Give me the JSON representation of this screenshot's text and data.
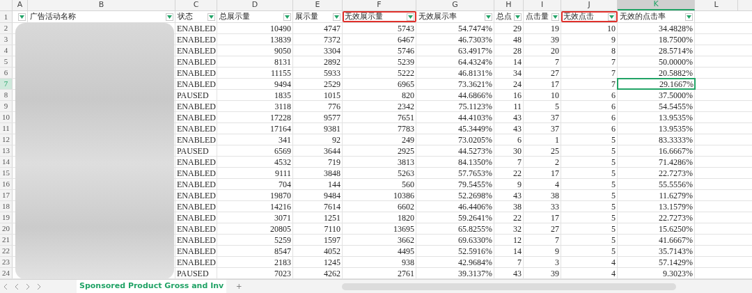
{
  "column_letters": [
    {
      "label": "A",
      "selected": false
    },
    {
      "label": "B",
      "selected": false
    },
    {
      "label": "C",
      "selected": false
    },
    {
      "label": "D",
      "selected": false
    },
    {
      "label": "E",
      "selected": false
    },
    {
      "label": "F",
      "selected": false
    },
    {
      "label": "G",
      "selected": false
    },
    {
      "label": "H",
      "selected": false
    },
    {
      "label": "I",
      "selected": false
    },
    {
      "label": "J",
      "selected": false
    },
    {
      "label": "K",
      "selected": true
    },
    {
      "label": "L",
      "selected": false
    }
  ],
  "header_row": {
    "number": "1",
    "cells": [
      {
        "highlighted": false
      },
      {
        "label": "广告活动名称",
        "highlighted": false
      },
      {
        "label": "状态",
        "highlighted": false
      },
      {
        "label": "总展示量",
        "highlighted": false
      },
      {
        "label": "展示量",
        "highlighted": false
      },
      {
        "label": "无效展示量",
        "highlighted": true
      },
      {
        "label": "无效展示率",
        "highlighted": false
      },
      {
        "label": "总点",
        "highlighted": false
      },
      {
        "label": "点击量",
        "highlighted": false
      },
      {
        "label": "无效点击",
        "highlighted": true
      },
      {
        "label": "无效的点击率",
        "highlighted": false
      }
    ]
  },
  "rows": [
    {
      "number": "2",
      "selected": false,
      "cells": [
        "ENABLED",
        "10490",
        "4747",
        "5743",
        "54.7474%",
        "29",
        "19",
        "10",
        "34.4828%"
      ]
    },
    {
      "number": "3",
      "selected": false,
      "cells": [
        "ENABLED",
        "13839",
        "7372",
        "6467",
        "46.7303%",
        "48",
        "39",
        "9",
        "18.7500%"
      ]
    },
    {
      "number": "4",
      "selected": false,
      "cells": [
        "ENABLED",
        "9050",
        "3304",
        "5746",
        "63.4917%",
        "28",
        "20",
        "8",
        "28.5714%"
      ]
    },
    {
      "number": "5",
      "selected": false,
      "cells": [
        "ENABLED",
        "8131",
        "2892",
        "5239",
        "64.4324%",
        "14",
        "7",
        "7",
        "50.0000%"
      ]
    },
    {
      "number": "6",
      "selected": false,
      "cells": [
        "ENABLED",
        "11155",
        "5933",
        "5222",
        "46.8131%",
        "34",
        "27",
        "7",
        "20.5882%"
      ]
    },
    {
      "number": "7",
      "selected": true,
      "cells": [
        "ENABLED",
        "9494",
        "2529",
        "6965",
        "73.3621%",
        "24",
        "17",
        "7",
        "29.1667%"
      ]
    },
    {
      "number": "8",
      "selected": false,
      "cells": [
        "PAUSED",
        "1835",
        "1015",
        "820",
        "44.6866%",
        "16",
        "10",
        "6",
        "37.5000%"
      ]
    },
    {
      "number": "9",
      "selected": false,
      "cells": [
        "ENABLED",
        "3118",
        "776",
        "2342",
        "75.1123%",
        "11",
        "5",
        "6",
        "54.5455%"
      ]
    },
    {
      "number": "10",
      "selected": false,
      "cells": [
        "ENABLED",
        "17228",
        "9577",
        "7651",
        "44.4103%",
        "43",
        "37",
        "6",
        "13.9535%"
      ]
    },
    {
      "number": "11",
      "selected": false,
      "cells": [
        "ENABLED",
        "17164",
        "9381",
        "7783",
        "45.3449%",
        "43",
        "37",
        "6",
        "13.9535%"
      ]
    },
    {
      "number": "12",
      "selected": false,
      "cells": [
        "ENABLED",
        "341",
        "92",
        "249",
        "73.0205%",
        "6",
        "1",
        "5",
        "83.3333%"
      ]
    },
    {
      "number": "13",
      "selected": false,
      "cells": [
        "PAUSED",
        "6569",
        "3644",
        "2925",
        "44.5273%",
        "30",
        "25",
        "5",
        "16.6667%"
      ]
    },
    {
      "number": "14",
      "selected": false,
      "cells": [
        "ENABLED",
        "4532",
        "719",
        "3813",
        "84.1350%",
        "7",
        "2",
        "5",
        "71.4286%"
      ]
    },
    {
      "number": "15",
      "selected": false,
      "cells": [
        "ENABLED",
        "9111",
        "3848",
        "5263",
        "57.7653%",
        "22",
        "17",
        "5",
        "22.7273%"
      ]
    },
    {
      "number": "16",
      "selected": false,
      "cells": [
        "ENABLED",
        "704",
        "144",
        "560",
        "79.5455%",
        "9",
        "4",
        "5",
        "55.5556%"
      ]
    },
    {
      "number": "17",
      "selected": false,
      "cells": [
        "ENABLED",
        "19870",
        "9484",
        "10386",
        "52.2698%",
        "43",
        "38",
        "5",
        "11.6279%"
      ]
    },
    {
      "number": "18",
      "selected": false,
      "cells": [
        "ENABLED",
        "14216",
        "7614",
        "6602",
        "46.4406%",
        "38",
        "33",
        "5",
        "13.1579%"
      ]
    },
    {
      "number": "19",
      "selected": false,
      "cells": [
        "ENABLED",
        "3071",
        "1251",
        "1820",
        "59.2641%",
        "22",
        "17",
        "5",
        "22.7273%"
      ]
    },
    {
      "number": "20",
      "selected": false,
      "cells": [
        "ENABLED",
        "20805",
        "7110",
        "13695",
        "65.8255%",
        "32",
        "27",
        "5",
        "15.6250%"
      ]
    },
    {
      "number": "21",
      "selected": false,
      "cells": [
        "ENABLED",
        "5259",
        "1597",
        "3662",
        "69.6330%",
        "12",
        "7",
        "5",
        "41.6667%"
      ]
    },
    {
      "number": "22",
      "selected": false,
      "cells": [
        "ENABLED",
        "8547",
        "4052",
        "4495",
        "52.5916%",
        "14",
        "9",
        "5",
        "35.7143%"
      ]
    },
    {
      "number": "23",
      "selected": false,
      "cells": [
        "ENABLED",
        "2183",
        "1245",
        "938",
        "42.9684%",
        "7",
        "3",
        "4",
        "57.1429%"
      ]
    },
    {
      "number": "24",
      "selected": false,
      "cells": [
        "PAUSED",
        "7023",
        "4262",
        "2761",
        "39.3137%",
        "43",
        "39",
        "4",
        "9.3023%"
      ]
    }
  ],
  "sheet_tab": {
    "label": "Sponsored Product Gross and Inv",
    "selected": true
  },
  "add_sheet": "+"
}
